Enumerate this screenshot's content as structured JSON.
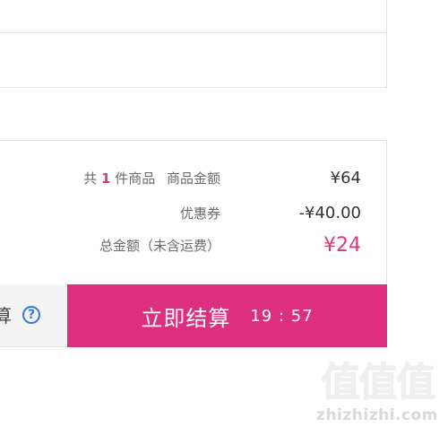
{
  "summary": {
    "count_prefix": "共",
    "count": "1",
    "count_suffix": "件商品",
    "goods_amount_label": "商品金额",
    "goods_amount_value": "¥64",
    "coupon_label": "优惠券",
    "coupon_value": "-¥40.00",
    "total_label": "总金额（未含运费）",
    "total_value": "¥24"
  },
  "action_bar": {
    "help_text": "算",
    "help_icon_glyph": "?",
    "checkout_label": "立即结算",
    "countdown": "19 : 57"
  },
  "colors": {
    "accent": "#dd2f7f",
    "total_price": "#d63a7e",
    "help_icon": "#2f7ed8"
  },
  "watermark": {
    "logo": "值值值",
    "url": "zhizhizhi.com"
  }
}
